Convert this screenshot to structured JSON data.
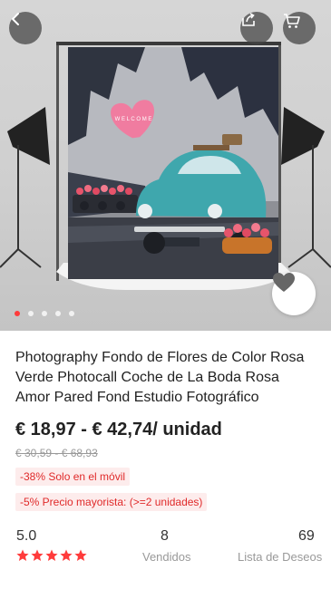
{
  "header": {
    "back_icon": "chevron-left-icon",
    "share_icon": "share-icon",
    "cart_icon": "cart-icon"
  },
  "gallery": {
    "image_count": 5,
    "active_index": 0,
    "favorite_icon": "heart-icon",
    "sign_text": "W E L C O M E"
  },
  "product": {
    "title": "Photography Fondo de Flores de Color Rosa Verde Photocall Coche de La Boda Rosa Amor Pared Fond Estudio Fotográfico",
    "price": "€ 18,97 - € 42,74/ unidad",
    "original_price": "€ 30,59 - € 68,93",
    "promo_mobile": "-38% Solo en el móvil",
    "promo_wholesale": "-5% Precio mayorista: (>=2 unidades)"
  },
  "stats": {
    "rating": "5.0",
    "rating_stars": 5,
    "sold_count": "8",
    "sold_label": "Vendidos",
    "wishlist_count": "69",
    "wishlist_label": "Lista de Deseos"
  },
  "colors": {
    "accent": "#ff3b3b",
    "promo_text": "#e02a2a",
    "promo_bg": "#fdecec",
    "car": "#3fa7ad",
    "heart_sign": "#f07ca0"
  }
}
